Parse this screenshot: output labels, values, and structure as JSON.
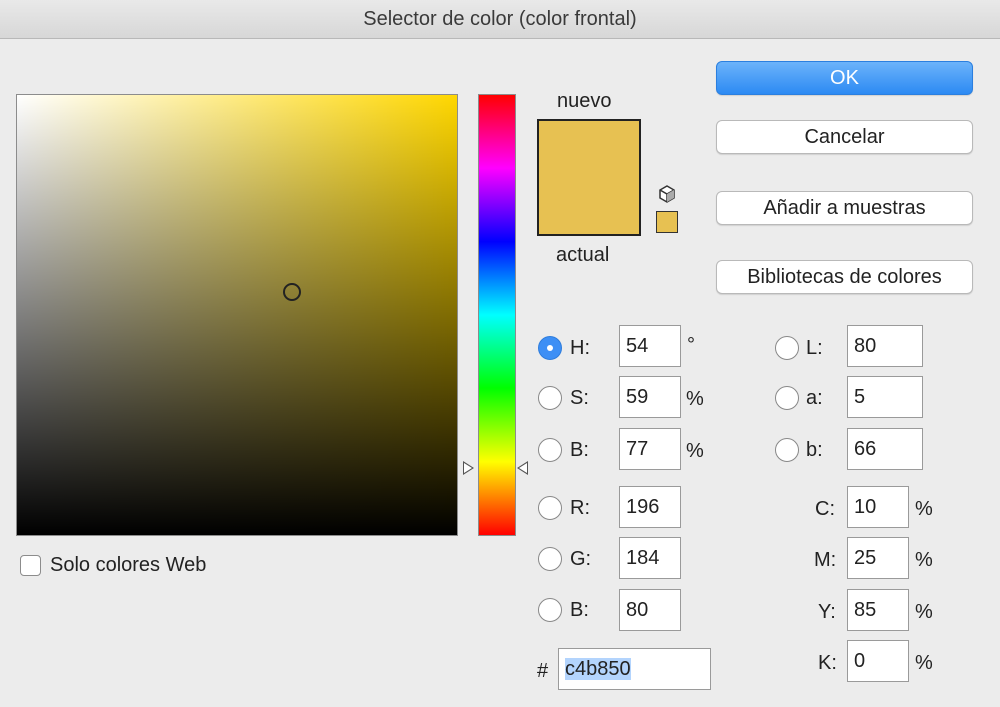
{
  "window": {
    "title": "Selector de color (color frontal)"
  },
  "picker": {
    "hue_color": "#ffd700"
  },
  "swatches": {
    "new_label": "nuevo",
    "current_label": "actual",
    "color": "#e7c152",
    "small_color": "#e7c152"
  },
  "buttons": {
    "ok": "OK",
    "cancel": "Cancelar",
    "add_to_swatches": "Añadir a muestras",
    "color_libraries": "Bibliotecas de colores"
  },
  "web_only": {
    "label": "Solo colores Web",
    "checked": false
  },
  "hsb": {
    "h": {
      "label": "H:",
      "value": "54",
      "unit": "°",
      "selected": true
    },
    "s": {
      "label": "S:",
      "value": "59",
      "unit": "%"
    },
    "b": {
      "label": "B:",
      "value": "77",
      "unit": "%"
    }
  },
  "rgb": {
    "r": {
      "label": "R:",
      "value": "196"
    },
    "g": {
      "label": "G:",
      "value": "184"
    },
    "b": {
      "label": "B:",
      "value": "80"
    }
  },
  "lab": {
    "l": {
      "label": "L:",
      "value": "80"
    },
    "a": {
      "label": "a:",
      "value": "5"
    },
    "b": {
      "label": "b:",
      "value": "66"
    }
  },
  "cmyk": {
    "c": {
      "label": "C:",
      "value": "10",
      "unit": "%"
    },
    "m": {
      "label": "M:",
      "value": "25",
      "unit": "%"
    },
    "y": {
      "label": "Y:",
      "value": "85",
      "unit": "%"
    },
    "k": {
      "label": "K:",
      "value": "0",
      "unit": "%"
    }
  },
  "hex": {
    "label": "#",
    "value": "c4b850"
  }
}
